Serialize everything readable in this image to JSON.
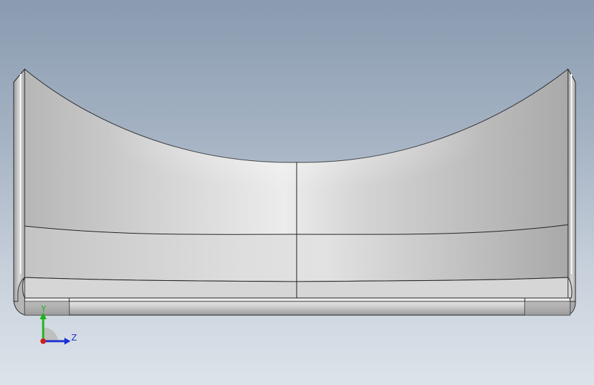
{
  "viewport": {
    "background_top": "#8a9bb0",
    "background_bottom": "#dde3ea"
  },
  "model": {
    "body_color": "#c9c9c9",
    "edge_color": "#1e1e1e"
  },
  "triad": {
    "y_label": "Y",
    "z_label": "Z",
    "y_color": "#19b419",
    "z_color": "#1c2fd0",
    "x_color": "#d01c1c"
  }
}
